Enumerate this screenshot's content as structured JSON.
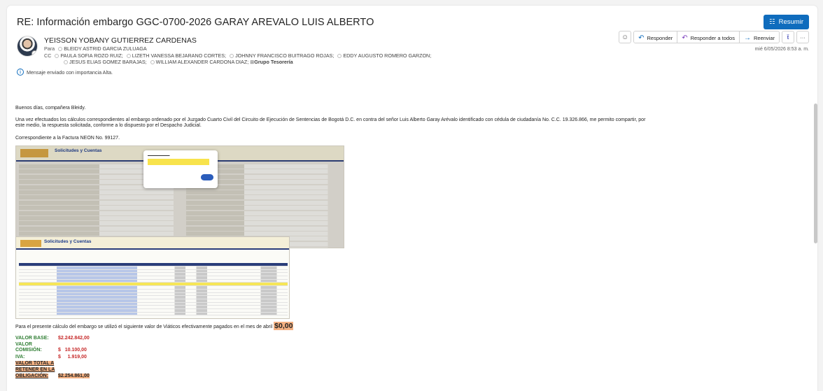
{
  "header": {
    "subject": "RE: Información embargo GGC-0700-2026 GARAY AREVALO LUIS ALBERTO",
    "summarize_label": "Resumir"
  },
  "sender": {
    "name": "YEISSON YOBANY GUTIERREZ CARDENAS",
    "to_label": "Para",
    "to": [
      "BLEIDY ASTRID GARCIA ZULUAGA"
    ],
    "cc_label": "CC",
    "cc_line1": [
      "PAULA SOFIA ROZO RUIZ;",
      "LIZETH VANESSA BEJARANO CORTES;",
      "JOHNNY FRANCISCO BUITRAGO ROJAS;",
      "EDDY AUGUSTO ROMERO GARZON;"
    ],
    "cc_line2": [
      "JESUS ELIAS GOMEZ BARAJAS;",
      "WILLIAM ALEXANDER CARDONA DIAZ;"
    ],
    "cc_group": "Grupo Tesorería",
    "date": "mié 6/05/2026 8:53 a. m.",
    "importance": "Mensaje enviado con importancia Alta."
  },
  "actions": {
    "reply": "Responder",
    "reply_all": "Responder a todos",
    "forward": "Reenviar",
    "more": "···"
  },
  "body": {
    "greeting": "Buenos días, compañera Bleidy.",
    "paragraph1_line1": "Una vez efectuados los cálculos correspondientes al embargo ordenado por el Juzgado Cuarto Civil del Circuito de Ejecución de Sentencias de Bogotá D.C. en contra del señor Luis Alberto Garay Arévalo identificado con cédula de ciudadanía No. C.C. 19.326.866, me permito compartir, por",
    "paragraph1_line2": "este medio, la respuesta solicitada, conforme a lo dispuesto por el Despacho Judicial.",
    "invoice": "Correspondiente a la Factura NEON No. 99127.",
    "viaticos_text": "Para el presente cálculo del embargo se utilizó el siguiente valor de Viáticos efectivamente pagados en el mes de abril",
    "viaticos_value": "$0,00",
    "screenshot1_title": "Solicitudes y Cuentas",
    "screenshot2_title": "Solicitudes y Cuentas"
  },
  "totals": {
    "base_label": "VALOR BASE:",
    "base_value": "$2.242.842,00",
    "commission_label_1": "VALOR",
    "commission_label_2": "COMISIÓN:",
    "commission_value": "$   10.100,00",
    "iva_label": "IVA:",
    "iva_value": "$     1.919,00",
    "total_label_1": "VALOR TOTAL A",
    "total_label_2": "RETENER EN LA",
    "total_label_3": "OBLIGACIÓN:",
    "total_value": "$2.254.861,00"
  },
  "colors": {
    "accent": "#0f6cbd",
    "green_label": "#2e7d32",
    "red_value": "#c62828",
    "highlight": "#f4b183"
  }
}
